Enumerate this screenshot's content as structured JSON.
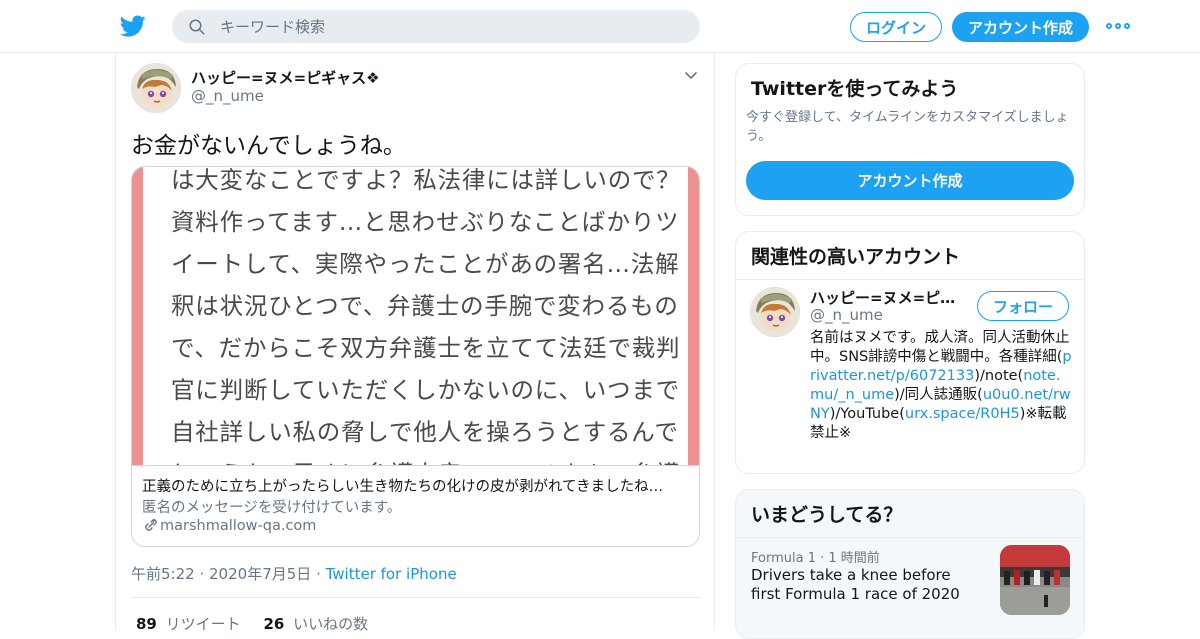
{
  "header": {
    "search_placeholder": "キーワード検索",
    "login_label": "ログイン",
    "signup_label": "アカウント作成"
  },
  "tweet": {
    "author_name": "ハッピー=ヌメ=ピギャス❖",
    "author_handle": "@_n_ume",
    "text": "お金がないんでしょうね。",
    "card": {
      "image_lines": [
        "は大変なことですよ？私法律には詳しいので？",
        "資料作ってます…と思わせぶりなことばかりツ",
        "イートして、実際やったことがあの署名…法解",
        "釈は状況ひとつで、弁護士の手腕で変わるもの",
        "で、だからこそ双方弁護士を立てて法廷で裁判",
        "官に判断していただくしかないのに、いつまで",
        "自社詳しい私の脅しで他人を操ろうとするんで",
        "しょうか。早めに弁護士雇ってヌメさんの弁護"
      ],
      "title": "正義のために立ち上がったらしい生き物たちの化けの皮が剥がれてきましたね…",
      "description": "匿名のメッセージを受け付けています。",
      "domain": "marshmallow-qa.com"
    },
    "time": "午前5:22",
    "date": "2020年7月5日",
    "source": "Twitter for iPhone",
    "retweet_count": "89",
    "retweet_label": "リツイート",
    "like_count": "26",
    "like_label": "いいねの数"
  },
  "sidebar": {
    "signup_box": {
      "title": "Twitterを使ってみよう",
      "subtitle": "今すぐ登録して、タイムラインをカスタマイズしましょう。",
      "button": "アカウント作成"
    },
    "related": {
      "title": "関連性の高いアカウント",
      "name": "ハッピー=ヌメ=ピギャス❖",
      "handle": "@_n_ume",
      "follow_label": "フォロー",
      "bio_parts": {
        "p1": "名前はヌメです。成人済。同人活動休止中。SNS誹謗中傷と戦闘中。各種詳細(",
        "l1": "privatter.net/p/6072133",
        "p2": ")/note(",
        "l2": "note.mu/_n_ume",
        "p3": ")/同人誌通販(",
        "l3": "u0u0.net/rwNY",
        "p4": ")/YouTube(",
        "l4": "urx.space/R0H5",
        "p5": ")※転載禁止※"
      }
    },
    "trends": {
      "title": "いまどうしてる？",
      "category": "Formula 1",
      "time": "1 時間前",
      "headline": "Drivers take a knee before first Formula 1 race of 2020"
    }
  },
  "colors": {
    "accent": "#1da1f2",
    "link": "#1b95e0",
    "secondary_text": "#657786",
    "card_frame": "#ee9191"
  }
}
